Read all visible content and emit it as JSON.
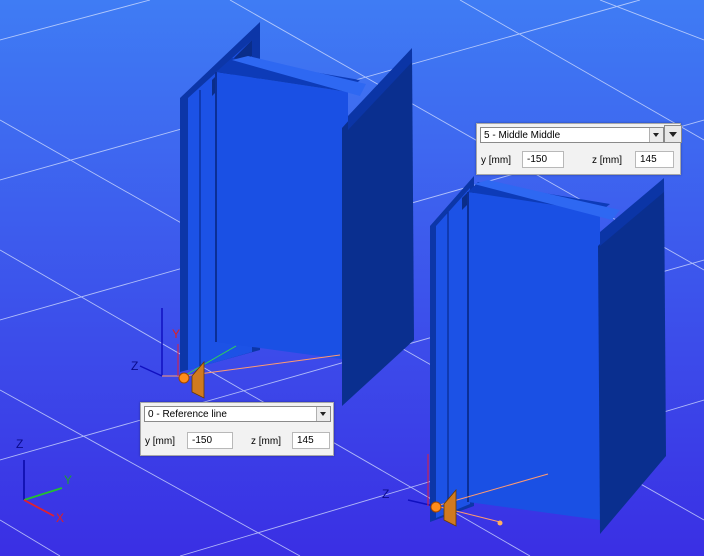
{
  "scene": {
    "colors": {
      "background_top": "#3a74f2",
      "background_bottom": "#3b30e6",
      "beam_face": "#1a4fe0",
      "beam_dark": "#0a2f8f",
      "beam_mid": "#1340c8"
    },
    "beam_left": {
      "axes": {
        "y_label": "Y",
        "z_label": "Z"
      },
      "panel": {
        "reference_point": "0 - Reference line",
        "y_label": "y [mm]",
        "y_value": "-150",
        "z_label": "z [mm]",
        "z_value": "145"
      }
    },
    "beam_right": {
      "axes": {
        "z_label": "Z"
      },
      "panel": {
        "reference_point": "5 - Middle Middle",
        "y_label": "y [mm]",
        "y_value": "-150",
        "z_label": "z [mm]",
        "z_value": "145"
      }
    },
    "global_axes": {
      "x_label": "X",
      "y_label": "Y",
      "z_label": "Z"
    }
  }
}
